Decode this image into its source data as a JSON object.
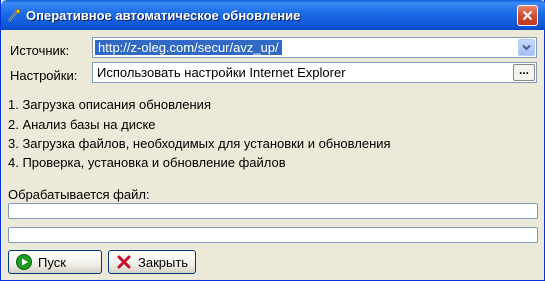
{
  "window": {
    "title": "Оперативное автоматическое обновление",
    "icons": {
      "app": "wand-icon",
      "close": "close-icon"
    }
  },
  "source": {
    "label": "Источник:",
    "value": "http://z-oleg.com/secur/avz_up/"
  },
  "settings": {
    "label": "Настройки:",
    "value": "Использовать настройки Internet Explorer",
    "browse_label": "..."
  },
  "steps": [
    "1. Загрузка описания обновления",
    "2. Анализ базы на диске",
    "3. Загрузка файлов, необходимых для установки и обновления",
    "4. Проверка, установка и обновление файлов"
  ],
  "processing": {
    "label": "Обрабатывается файл:",
    "file_progress": 0,
    "total_progress": 0
  },
  "buttons": {
    "start": {
      "label": "Пуск",
      "icon": "play-icon"
    },
    "close": {
      "label": "Закрыть",
      "icon": "close-x-icon"
    }
  },
  "colors": {
    "titlebar": "#0a58d6",
    "selection": "#316ac5",
    "close_button": "#d1452b",
    "play_icon": "#1e9b22",
    "close_x_icon": "#c8102e"
  }
}
